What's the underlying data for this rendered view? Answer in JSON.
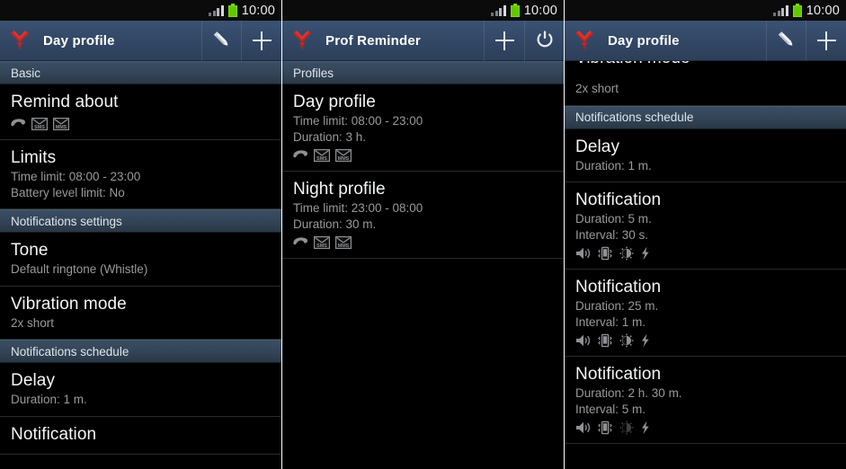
{
  "status_bar": {
    "time": "10:00",
    "signal_icon": "signal-bars-icon",
    "battery_icon": "battery-icon"
  },
  "colors": {
    "accent_actionbar": "#334866",
    "section_header": "#334456",
    "list_bg": "#000000",
    "title_text": "#f4f6f7",
    "sub_text": "#9a9a9a",
    "battery_green": "#64c800",
    "logo_red": "#d0211f"
  },
  "panels": [
    {
      "name": "day-profile-top",
      "actionbar": {
        "title": "Day profile",
        "logo_icon": "prof-reminder-logo-icon",
        "buttons": [
          {
            "icon": "pencil-edit-icon",
            "label": ""
          },
          {
            "icon": "plus-add-icon",
            "label": ""
          }
        ]
      },
      "list": [
        {
          "kind": "section",
          "label": "Basic"
        },
        {
          "kind": "item",
          "title": "Remind about",
          "subs": [],
          "icons": [
            "call-icon",
            "sms-icon",
            "mms-icon"
          ],
          "icons_dim": []
        },
        {
          "kind": "item",
          "title": "Limits",
          "subs": [
            "Time limit: 08:00 - 23:00",
            "Battery level limit: No"
          ],
          "icons": [],
          "icons_dim": []
        },
        {
          "kind": "section",
          "label": "Notifications settings"
        },
        {
          "kind": "item",
          "title": "Tone",
          "subs": [
            "Default ringtone (Whistle)"
          ],
          "icons": [],
          "icons_dim": []
        },
        {
          "kind": "item",
          "title": "Vibration mode",
          "subs": [
            "2x short"
          ],
          "icons": [],
          "icons_dim": []
        },
        {
          "kind": "section",
          "label": "Notifications schedule"
        },
        {
          "kind": "item",
          "title": "Delay",
          "subs": [
            "Duration: 1 m."
          ],
          "icons": [],
          "icons_dim": []
        },
        {
          "kind": "item",
          "title": "Notification",
          "subs": [],
          "icons": [],
          "icons_dim": []
        }
      ]
    },
    {
      "name": "profiles-list",
      "actionbar": {
        "title": "Prof Reminder",
        "logo_icon": "prof-reminder-logo-icon",
        "buttons": [
          {
            "icon": "plus-add-icon",
            "label": ""
          },
          {
            "icon": "power-toggle-icon",
            "label": ""
          }
        ]
      },
      "list": [
        {
          "kind": "section",
          "label": "Profiles"
        },
        {
          "kind": "item",
          "title": "Day profile",
          "subs": [
            "Time limit: 08:00 - 23:00",
            "Duration: 3 h."
          ],
          "icons": [
            "call-icon",
            "sms-icon",
            "mms-icon"
          ],
          "icons_dim": []
        },
        {
          "kind": "item",
          "title": "Night profile",
          "subs": [
            "Time limit: 23:00 - 08:00",
            "Duration: 30 m."
          ],
          "icons": [
            "call-icon",
            "sms-icon",
            "mms-icon"
          ],
          "icons_dim": []
        }
      ]
    },
    {
      "name": "day-profile-scrolled",
      "actionbar": {
        "title": "Day profile",
        "logo_icon": "prof-reminder-logo-icon",
        "buttons": [
          {
            "icon": "pencil-edit-icon",
            "label": ""
          },
          {
            "icon": "plus-add-icon",
            "label": ""
          }
        ]
      },
      "partial_title": "Vibration mode",
      "list": [
        {
          "kind": "item",
          "title": "",
          "subs": [
            "2x short"
          ],
          "icons": [],
          "icons_dim": []
        },
        {
          "kind": "section",
          "label": "Notifications schedule"
        },
        {
          "kind": "item",
          "title": "Delay",
          "subs": [
            "Duration: 1 m."
          ],
          "icons": [],
          "icons_dim": []
        },
        {
          "kind": "item",
          "title": "Notification",
          "subs": [
            "Duration: 5 m.",
            "Interval: 30 s."
          ],
          "icons": [
            "sound-icon",
            "vibrate-icon",
            "brightness-icon",
            "flash-icon"
          ],
          "icons_dim": []
        },
        {
          "kind": "item",
          "title": "Notification",
          "subs": [
            "Duration: 25 m.",
            "Interval: 1 m."
          ],
          "icons": [
            "sound-icon",
            "vibrate-icon",
            "brightness-icon",
            "flash-icon"
          ],
          "icons_dim": []
        },
        {
          "kind": "item",
          "title": "Notification",
          "subs": [
            "Duration: 2 h. 30 m.",
            "Interval: 5 m."
          ],
          "icons": [
            "sound-icon",
            "vibrate-icon",
            "brightness-icon",
            "flash-icon"
          ],
          "icons_dim": [
            "brightness-icon"
          ]
        }
      ]
    }
  ]
}
